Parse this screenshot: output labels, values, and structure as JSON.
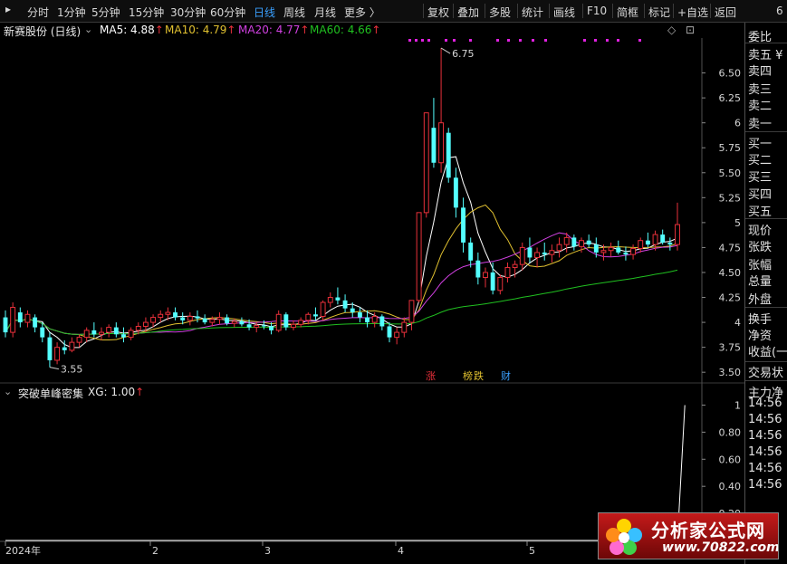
{
  "toolbar": {
    "periods": [
      "分时",
      "1分钟",
      "5分钟",
      "15分钟",
      "30分钟",
      "60分钟",
      "日线",
      "周线",
      "月线",
      "更多 〉"
    ],
    "active_period": "日线",
    "tools": [
      "复权",
      "叠加",
      "多股",
      "统计",
      "画线",
      "F10",
      "简框",
      "标记",
      "+自选",
      "返回"
    ],
    "corner": "6"
  },
  "header": {
    "stock": "新赛股份 (日线)",
    "ma5": "MA5: 4.88",
    "ma10": "MA10: 4.79",
    "ma20": "MA20: 4.77",
    "ma60": "MA60: 4.66",
    "arrow": "↑"
  },
  "indicator": {
    "name": "突破单峰密集",
    "value": "XG: 1.00",
    "arrow": "↑"
  },
  "right_panel": {
    "items": [
      "委比",
      "卖五 ¥",
      "卖四",
      "卖三",
      "卖二",
      "卖一",
      "买一",
      "买二",
      "买三",
      "买四",
      "买五",
      "现价",
      "张跌",
      "张幅",
      "总量",
      "外盘",
      "换手",
      "净资",
      "收益(一",
      "交易状",
      "主力净",
      "14:56",
      "14:56",
      "14:56",
      "14:56",
      "14:56",
      "14:56"
    ]
  },
  "markers": {
    "zhang": "涨",
    "bang": "榜",
    "die": "跌",
    "cai": "财"
  },
  "logo": {
    "title": "分析家公式网",
    "url": "www.70822.com"
  },
  "colors": {
    "up": "#e8303a",
    "down": "#54ffff",
    "ma5": "#ffffff",
    "ma10": "#e0c030",
    "ma20": "#d040e0",
    "ma60": "#20c020",
    "magenta_dots": "#e020e0"
  },
  "chart_data": [
    {
      "type": "candlestick",
      "title": "新赛股份 (日线)",
      "y_ticks": [
        6.5,
        6.25,
        6.0,
        5.75,
        5.5,
        5.25,
        5.0,
        4.75,
        4.5,
        4.25,
        4.0,
        3.75,
        3.5
      ],
      "ylim": [
        3.42,
        6.85
      ],
      "x_ticks": [
        "2024年",
        "2",
        "3",
        "4",
        "5"
      ],
      "annotations": {
        "high_label": "6.75",
        "low_label": "3.55"
      },
      "ohlc": [
        [
          4.05,
          4.12,
          3.85,
          3.9
        ],
        [
          3.9,
          4.2,
          3.85,
          4.15
        ],
        [
          4.1,
          4.15,
          3.95,
          4.0
        ],
        [
          4.0,
          4.12,
          3.95,
          4.08
        ],
        [
          4.05,
          4.08,
          3.9,
          3.95
        ],
        [
          3.95,
          4.0,
          3.8,
          3.85
        ],
        [
          3.85,
          3.9,
          3.55,
          3.62
        ],
        [
          3.62,
          3.8,
          3.58,
          3.75
        ],
        [
          3.75,
          3.82,
          3.68,
          3.72
        ],
        [
          3.72,
          3.85,
          3.7,
          3.8
        ],
        [
          3.8,
          3.88,
          3.75,
          3.85
        ],
        [
          3.85,
          3.95,
          3.8,
          3.92
        ],
        [
          3.92,
          4.0,
          3.85,
          3.88
        ],
        [
          3.88,
          3.95,
          3.82,
          3.9
        ],
        [
          3.9,
          3.98,
          3.85,
          3.95
        ],
        [
          3.95,
          4.0,
          3.85,
          3.88
        ],
        [
          3.88,
          3.95,
          3.8,
          3.85
        ],
        [
          3.85,
          3.95,
          3.82,
          3.92
        ],
        [
          3.92,
          4.0,
          3.88,
          3.96
        ],
        [
          3.96,
          4.05,
          3.9,
          4.0
        ],
        [
          4.0,
          4.08,
          3.95,
          4.05
        ],
        [
          4.05,
          4.12,
          4.0,
          4.08
        ],
        [
          4.08,
          4.15,
          4.02,
          4.1
        ],
        [
          4.1,
          4.15,
          4.02,
          4.05
        ],
        [
          4.05,
          4.1,
          3.98,
          4.02
        ],
        [
          4.02,
          4.1,
          3.97,
          4.06
        ],
        [
          4.06,
          4.12,
          4.0,
          4.04
        ],
        [
          4.04,
          4.08,
          3.98,
          4.0
        ],
        [
          4.0,
          4.06,
          3.96,
          4.03
        ],
        [
          4.03,
          4.1,
          3.98,
          4.05
        ],
        [
          4.05,
          4.08,
          3.97,
          3.99
        ],
        [
          3.99,
          4.04,
          3.95,
          4.01
        ],
        [
          4.01,
          4.05,
          3.96,
          3.98
        ],
        [
          3.98,
          4.03,
          3.92,
          3.95
        ],
        [
          3.95,
          4.0,
          3.9,
          3.97
        ],
        [
          3.97,
          4.02,
          3.93,
          3.96
        ],
        [
          3.96,
          4.0,
          3.88,
          3.92
        ],
        [
          3.92,
          4.12,
          3.9,
          4.08
        ],
        [
          4.08,
          4.1,
          3.92,
          3.95
        ],
        [
          3.95,
          4.02,
          3.92,
          3.98
        ],
        [
          3.98,
          4.05,
          3.95,
          4.02
        ],
        [
          4.02,
          4.1,
          3.98,
          4.08
        ],
        [
          4.08,
          4.15,
          4.02,
          4.06
        ],
        [
          4.06,
          4.22,
          4.02,
          4.2
        ],
        [
          4.2,
          4.3,
          4.15,
          4.25
        ],
        [
          4.25,
          4.35,
          4.18,
          4.22
        ],
        [
          4.22,
          4.28,
          4.1,
          4.14
        ],
        [
          4.14,
          4.2,
          4.05,
          4.1
        ],
        [
          4.1,
          4.15,
          4.0,
          4.05
        ],
        [
          4.05,
          4.12,
          3.95,
          4.0
        ],
        [
          4.0,
          4.1,
          3.95,
          4.06
        ],
        [
          4.06,
          4.08,
          3.92,
          3.96
        ],
        [
          3.96,
          4.0,
          3.8,
          3.85
        ],
        [
          3.85,
          3.95,
          3.78,
          3.9
        ],
        [
          3.9,
          4.05,
          3.85,
          4.0
        ],
        [
          4.0,
          4.22,
          3.92,
          4.22
        ],
        [
          4.22,
          5.1,
          4.2,
          5.1
        ],
        [
          5.1,
          6.1,
          5.05,
          6.1
        ],
        [
          5.95,
          6.25,
          5.55,
          5.6
        ],
        [
          5.6,
          6.75,
          5.5,
          6.0
        ],
        [
          5.9,
          5.95,
          5.4,
          5.45
        ],
        [
          5.45,
          5.55,
          5.05,
          5.15
        ],
        [
          5.15,
          5.25,
          4.7,
          4.8
        ],
        [
          4.8,
          4.85,
          4.55,
          4.62
        ],
        [
          4.62,
          4.7,
          4.38,
          4.45
        ],
        [
          4.45,
          4.55,
          4.35,
          4.5
        ],
        [
          4.5,
          4.6,
          4.28,
          4.32
        ],
        [
          4.32,
          4.48,
          4.28,
          4.45
        ],
        [
          4.45,
          4.6,
          4.4,
          4.55
        ],
        [
          4.55,
          4.62,
          4.45,
          4.58
        ],
        [
          4.58,
          4.8,
          4.52,
          4.75
        ],
        [
          4.75,
          4.85,
          4.6,
          4.65
        ],
        [
          4.65,
          4.75,
          4.55,
          4.7
        ],
        [
          4.7,
          4.8,
          4.62,
          4.68
        ],
        [
          4.68,
          4.78,
          4.6,
          4.72
        ],
        [
          4.72,
          4.85,
          4.65,
          4.78
        ],
        [
          4.78,
          4.9,
          4.7,
          4.85
        ],
        [
          4.85,
          4.88,
          4.72,
          4.76
        ],
        [
          4.76,
          4.85,
          4.7,
          4.82
        ],
        [
          4.82,
          4.88,
          4.75,
          4.78
        ],
        [
          4.78,
          4.85,
          4.65,
          4.7
        ],
        [
          4.7,
          4.78,
          4.62,
          4.72
        ],
        [
          4.72,
          4.8,
          4.66,
          4.75
        ],
        [
          4.75,
          4.82,
          4.68,
          4.7
        ],
        [
          4.7,
          4.76,
          4.62,
          4.68
        ],
        [
          4.68,
          4.78,
          4.63,
          4.74
        ],
        [
          4.74,
          4.85,
          4.7,
          4.82
        ],
        [
          4.82,
          4.9,
          4.75,
          4.78
        ],
        [
          4.78,
          4.92,
          4.72,
          4.88
        ],
        [
          4.88,
          4.93,
          4.78,
          4.8
        ],
        [
          4.8,
          4.85,
          4.72,
          4.78
        ],
        [
          4.78,
          5.2,
          4.72,
          4.98
        ]
      ],
      "ma5_last": 4.88,
      "ma10_last": 4.79,
      "ma20_last": 4.77,
      "ma60_last": 4.66
    },
    {
      "type": "line",
      "title": "突破单峰密集",
      "y_ticks": [
        1.0,
        0.8,
        0.6,
        0.4,
        0.2
      ],
      "ylim": [
        0.0,
        1.05
      ],
      "series": [
        {
          "name": "XG",
          "values": [
            0,
            0,
            0,
            0,
            0,
            0,
            0,
            0,
            0,
            0,
            0,
            0,
            0,
            0,
            0,
            0,
            0,
            0,
            0,
            0,
            0,
            0,
            0,
            0,
            0,
            0,
            0,
            0,
            0,
            0,
            0,
            0,
            0,
            0,
            0,
            0,
            0,
            0,
            0,
            0,
            0,
            0,
            0,
            0,
            0,
            0,
            0,
            0,
            0,
            0,
            0,
            0,
            0,
            0,
            0,
            0,
            0,
            0,
            0,
            0,
            0,
            0,
            0,
            0,
            0,
            0,
            0,
            0,
            0,
            0,
            0,
            0,
            0,
            0,
            0,
            0,
            0,
            0,
            0,
            0,
            0,
            0,
            0,
            0,
            0,
            0,
            0,
            0,
            0,
            0,
            0,
            0,
            1.0
          ]
        }
      ]
    }
  ]
}
